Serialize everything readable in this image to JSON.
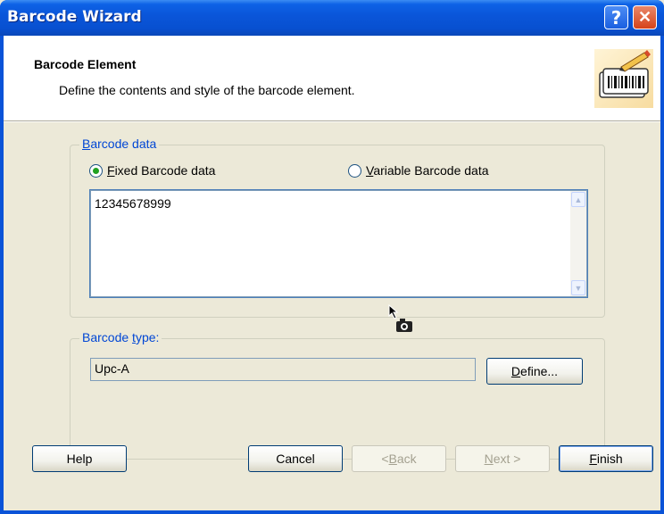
{
  "window": {
    "title": "Barcode Wizard",
    "help_icon": "help-icon",
    "close_icon": "close-icon"
  },
  "header": {
    "title": "Barcode Element",
    "subtitle": "Define the contents and style of the barcode element.",
    "icon": "barcode-pen-icon"
  },
  "barcode_data": {
    "legend_u": "B",
    "legend_rest": "arcode data",
    "fixed": {
      "u": "F",
      "rest": "ixed Barcode data",
      "selected": true
    },
    "variable": {
      "u": "V",
      "rest": "ariable Barcode data",
      "selected": false
    },
    "value": "12345678999"
  },
  "barcode_type": {
    "legend_pre": "Barcode ",
    "legend_u": "t",
    "legend_rest": "ype:",
    "value": "Upc-A",
    "define_u": "D",
    "define_rest": "efine..."
  },
  "buttons": {
    "help": "Help",
    "cancel": "Cancel",
    "back_pre": "< ",
    "back_u": "B",
    "back_rest": "ack",
    "next_u": "N",
    "next_rest": "ext >",
    "finish_u": "F",
    "finish_rest": "inish"
  },
  "colors": {
    "titlebar": "#0a55d9",
    "dialog_bg": "#ece9d8",
    "legend": "#0046d5",
    "radio_dot": "#21a121"
  }
}
